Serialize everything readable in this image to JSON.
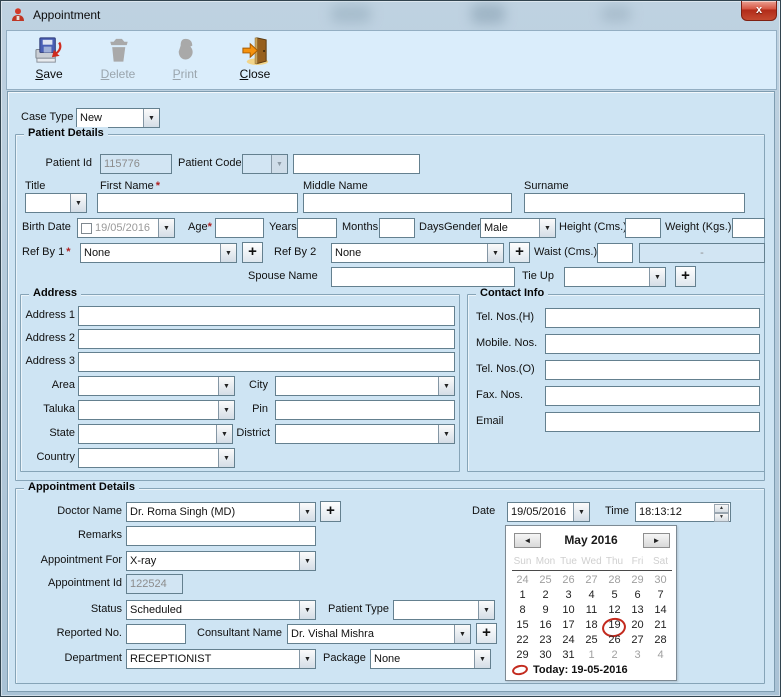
{
  "ui": {
    "required_marker": "*",
    "dropdown_arrow": "▼",
    "spin_up": "▲",
    "spin_down": "▼",
    "plus": "+",
    "prev": "◄",
    "next": "►",
    "close_x": "x"
  },
  "colors": {
    "dialog_bg": "#cee4f3",
    "toolbar_bg": "#daedfb",
    "close_button_red": "#c44a30",
    "required_red": "#b02020",
    "calendar_circle_red": "#c32a1e"
  },
  "window": {
    "title": "Appointment"
  },
  "toolbar": {
    "save_label": "Save",
    "delete_label": "Delete",
    "print_label": "Print",
    "close_label": "Close"
  },
  "form": {
    "case_type_label": "Case Type",
    "case_type_value": "New"
  },
  "patient": {
    "section_title": "Patient Details",
    "patient_id_label": "Patient Id",
    "patient_id_value": "115776",
    "patient_code_label": "Patient Code",
    "title_label": "Title",
    "first_name_label": "First Name",
    "middle_name_label": "Middle Name",
    "surname_label": "Surname",
    "birth_date_label": "Birth Date",
    "birth_date_value": "19/05/2016",
    "age_label": "Age",
    "years_label": "Years",
    "months_label": "Months",
    "days_label": "Days",
    "gender_label": "Gender",
    "gender_value": "Male",
    "height_label": "Height (Cms.)",
    "weight_label": "Weight (Kgs.)",
    "ref_by_1_label": "Ref By 1",
    "ref_by_1_value": "None",
    "ref_by_2_label": "Ref By 2",
    "ref_by_2_value": "None",
    "waist_label": "Waist (Cms.)",
    "waist_alt_value": "-",
    "spouse_label": "Spouse Name",
    "tie_up_label": "Tie Up"
  },
  "address": {
    "section_title": "Address",
    "address1_label": "Address 1",
    "address2_label": "Address 2",
    "address3_label": "Address 3",
    "area_label": "Area",
    "city_label": "City",
    "taluka_label": "Taluka",
    "pin_label": "Pin",
    "state_label": "State",
    "district_label": "District",
    "country_label": "Country"
  },
  "contact": {
    "section_title": "Contact Info",
    "tel_h_label": "Tel. Nos.(H)",
    "mobile_label": "Mobile. Nos.",
    "tel_o_label": "Tel. Nos.(O)",
    "fax_label": "Fax. Nos.",
    "email_label": "Email"
  },
  "appointment": {
    "section_title": "Appointment Details",
    "doctor_label": "Doctor Name",
    "doctor_value": "Dr. Roma Singh (MD)",
    "date_label": "Date",
    "date_value": "19/05/2016",
    "time_label": "Time",
    "time_value": "18:13:12",
    "remarks_label": "Remarks",
    "appointment_for_label": "Appointment For",
    "appointment_for_value": "X-ray",
    "appointment_id_label": "Appointment Id",
    "appointment_id_value": "122524",
    "status_label": "Status",
    "status_value": "Scheduled",
    "patient_type_label": "Patient Type",
    "reported_no_label": "Reported No.",
    "consultant_label": "Consultant Name",
    "consultant_value": "Dr. Vishal Mishra",
    "department_label": "Department",
    "department_value": "RECEPTIONIST",
    "package_label": "Package",
    "package_value": "None"
  },
  "calendar": {
    "month_title": "May 2016",
    "day_headers": [
      "Sun",
      "Mon",
      "Tue",
      "Wed",
      "Thu",
      "Fri",
      "Sat"
    ],
    "cells": [
      {
        "t": "24",
        "m": 1
      },
      {
        "t": "25",
        "m": 1
      },
      {
        "t": "26",
        "m": 1
      },
      {
        "t": "27",
        "m": 1
      },
      {
        "t": "28",
        "m": 1
      },
      {
        "t": "29",
        "m": 1
      },
      {
        "t": "30",
        "m": 1
      },
      {
        "t": "1"
      },
      {
        "t": "2"
      },
      {
        "t": "3"
      },
      {
        "t": "4"
      },
      {
        "t": "5"
      },
      {
        "t": "6"
      },
      {
        "t": "7"
      },
      {
        "t": "8"
      },
      {
        "t": "9"
      },
      {
        "t": "10"
      },
      {
        "t": "11"
      },
      {
        "t": "12"
      },
      {
        "t": "13"
      },
      {
        "t": "14"
      },
      {
        "t": "15"
      },
      {
        "t": "16"
      },
      {
        "t": "17"
      },
      {
        "t": "18"
      },
      {
        "t": "19",
        "c": 1
      },
      {
        "t": "20"
      },
      {
        "t": "21"
      },
      {
        "t": "22"
      },
      {
        "t": "23"
      },
      {
        "t": "24"
      },
      {
        "t": "25"
      },
      {
        "t": "26"
      },
      {
        "t": "27"
      },
      {
        "t": "28"
      },
      {
        "t": "29"
      },
      {
        "t": "30"
      },
      {
        "t": "31"
      },
      {
        "t": "1",
        "m": 1
      },
      {
        "t": "2",
        "m": 1
      },
      {
        "t": "3",
        "m": 1
      },
      {
        "t": "4",
        "m": 1
      }
    ],
    "today_label": "Today: 19-05-2016"
  }
}
